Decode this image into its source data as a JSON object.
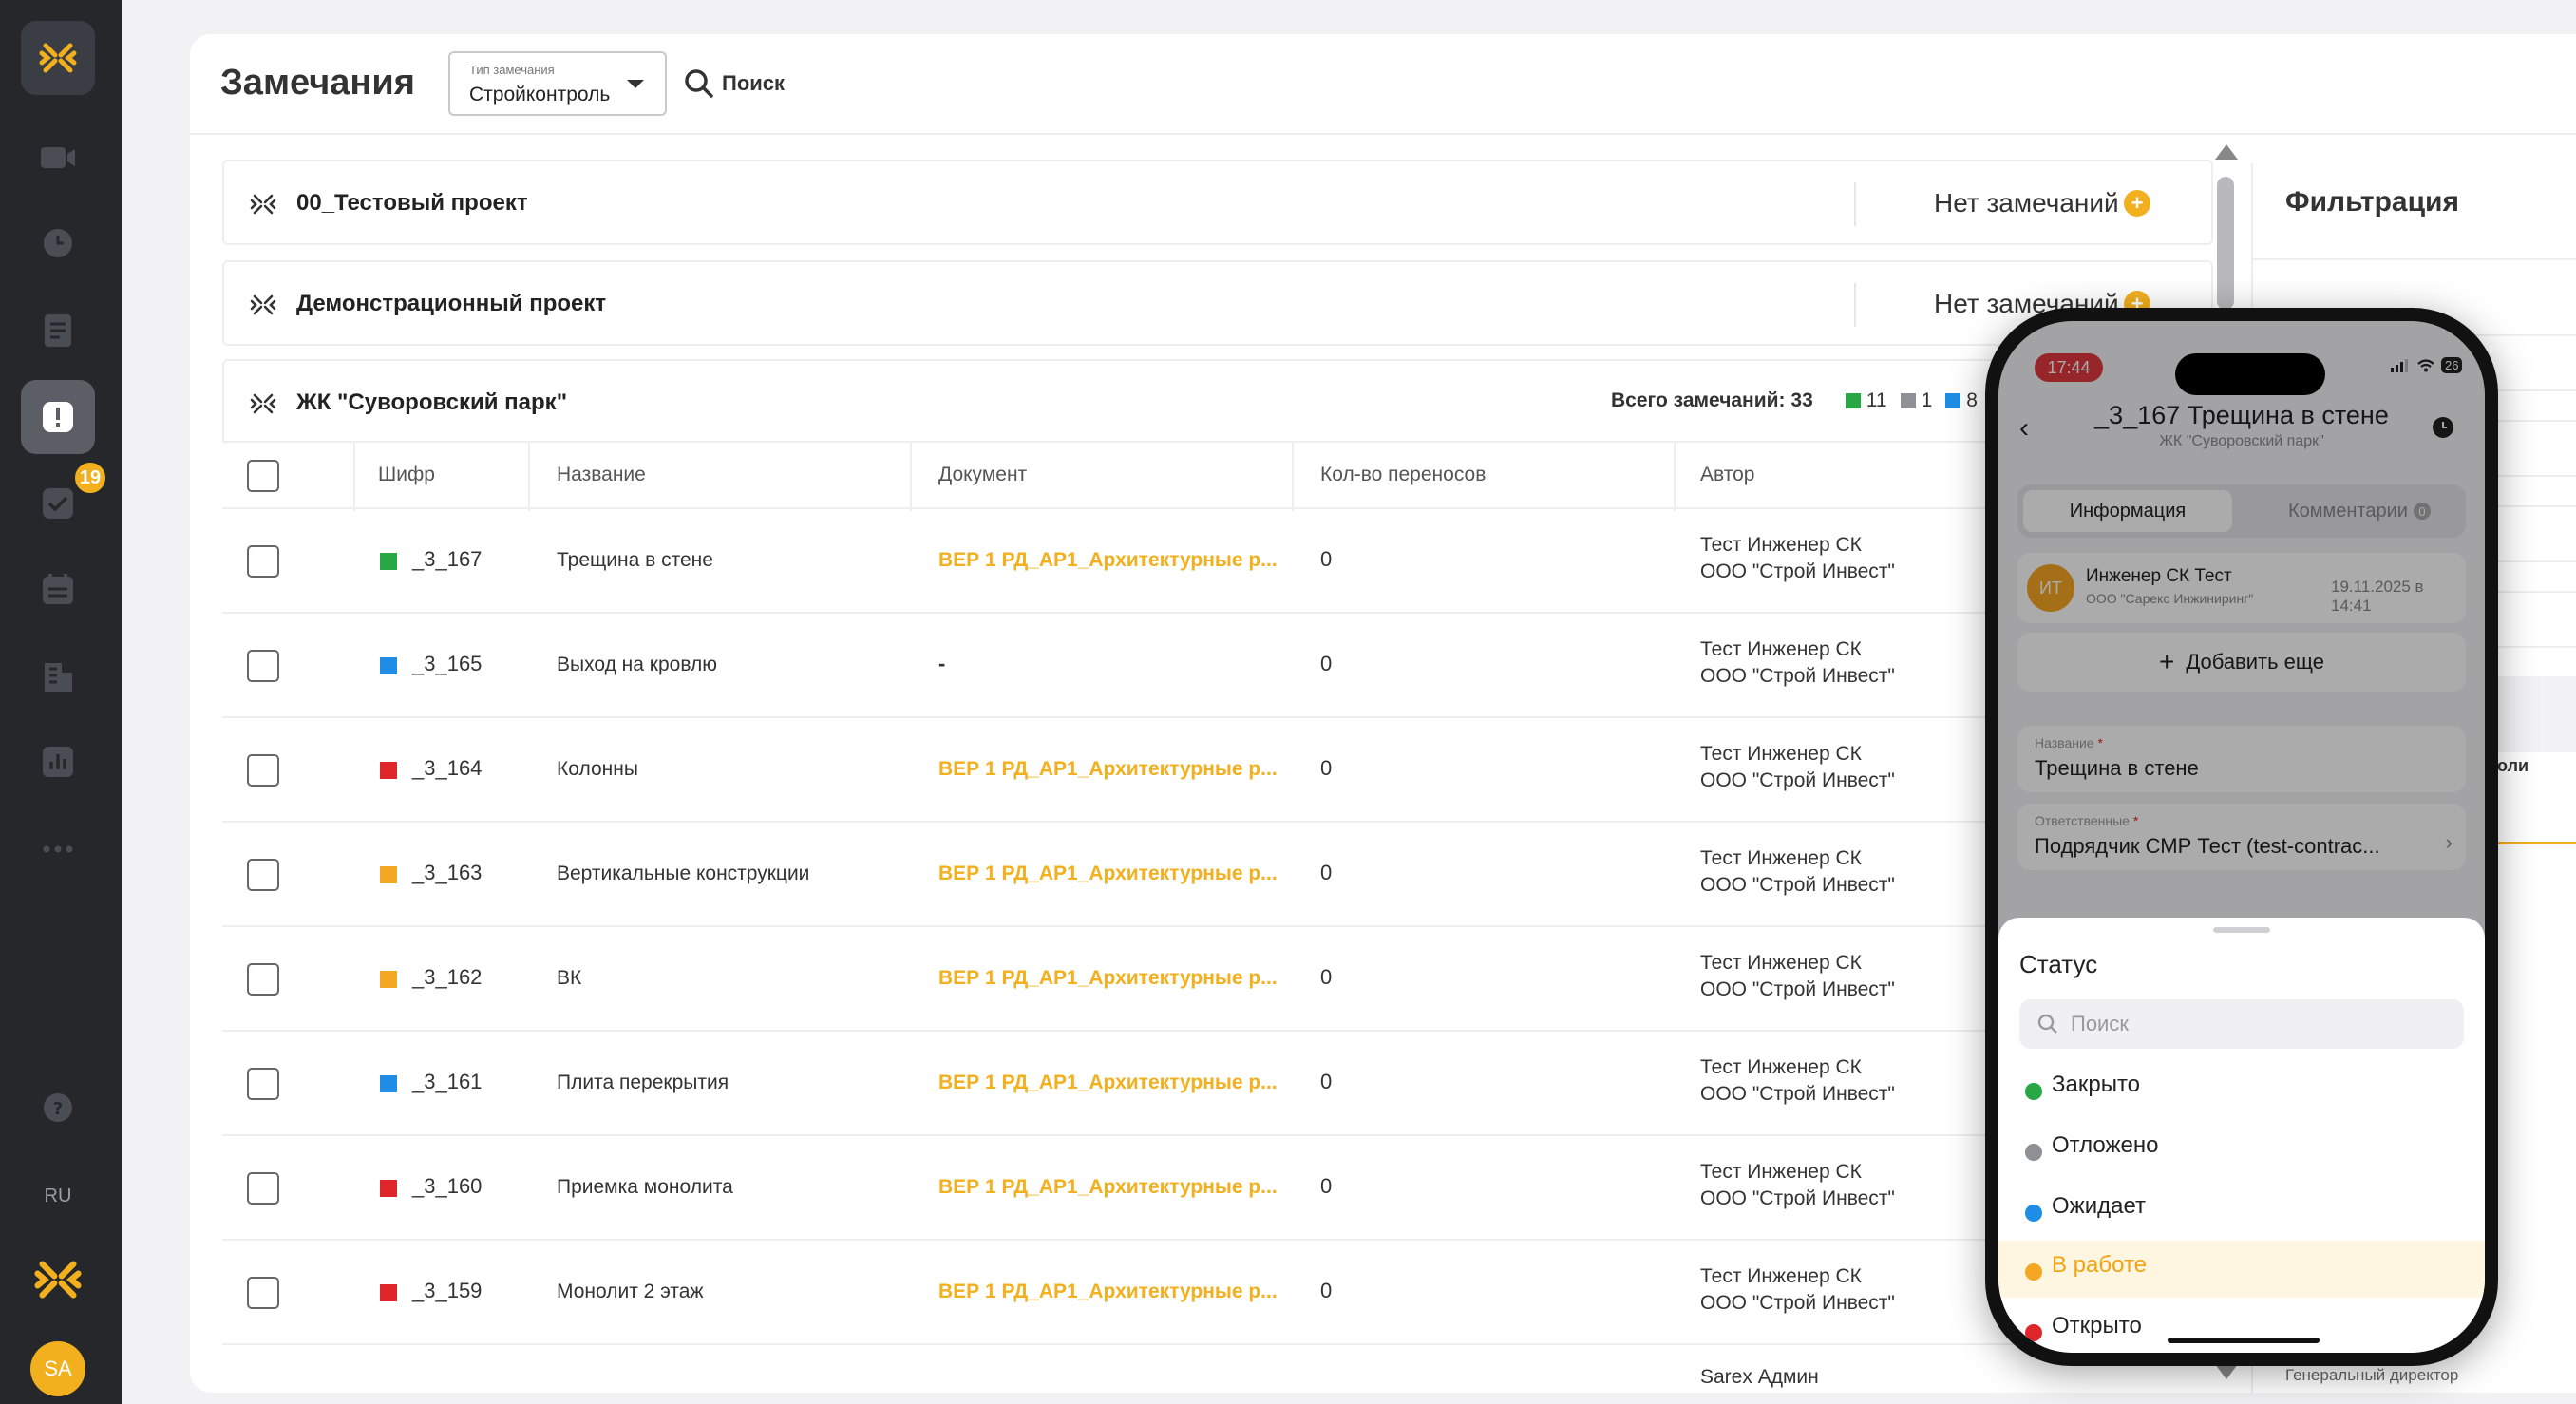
{
  "sidebar": {
    "badge": "19",
    "lang": "RU",
    "avatar": "SA",
    "items": [
      "logo-icon",
      "video-icon",
      "clock-icon",
      "documents-icon",
      "remarks-icon",
      "tasks-icon",
      "calendar-icon",
      "buildings-icon",
      "analytics-icon",
      "more-icon",
      "help-icon"
    ]
  },
  "header": {
    "title": "Замечания",
    "type_label": "Тип замечания",
    "type_value": "Стройконтроль",
    "search": "Поиск"
  },
  "projects": [
    {
      "name": "00_Тестовый проект",
      "status": "Нет замечаний"
    },
    {
      "name": "Демонстрационный проект",
      "status": "Нет замечаний"
    },
    {
      "name": "ЖК \"Суворовский парк\""
    }
  ],
  "stats": {
    "total": "Всего замечаний: 33",
    "green": "11",
    "grey": "1",
    "blue": "8"
  },
  "colors": {
    "accent": "#f2b01e",
    "green": "#27a844",
    "grey": "#8e9096",
    "blue": "#1f8de6",
    "red": "#e0262b",
    "orange": "#f5a623"
  },
  "table": {
    "headers": [
      "Шифр",
      "Название",
      "Документ",
      "Кол-во переносов",
      "Автор"
    ],
    "rows": [
      {
        "code": "_3_167",
        "color": "#27a844",
        "name": "Трещина в стене",
        "doc": "ВЕР 1 РД_АР1_Архитектурные р...",
        "moves": "0",
        "author": "Тест Инженер СК",
        "company": "ООО \"Строй Инвест\""
      },
      {
        "code": "_3_165",
        "color": "#1f8de6",
        "name": "Выход на кровлю",
        "doc": "-",
        "moves": "0",
        "author": "Тест Инженер СК",
        "company": "ООО \"Строй Инвест\""
      },
      {
        "code": "_3_164",
        "color": "#e0262b",
        "name": "Колонны",
        "doc": "ВЕР 1 РД_АР1_Архитектурные р...",
        "moves": "0",
        "author": "Тест Инженер СК",
        "company": "ООО \"Строй Инвест\""
      },
      {
        "code": "_3_163",
        "color": "#f5a623",
        "name": "Вертикальные конструкции",
        "doc": "ВЕР 1 РД_АР1_Архитектурные р...",
        "moves": "0",
        "author": "Тест Инженер СК",
        "company": "ООО \"Строй Инвест\""
      },
      {
        "code": "_3_162",
        "color": "#f5a623",
        "name": "ВК",
        "doc": "ВЕР 1 РД_АР1_Архитектурные р...",
        "moves": "0",
        "author": "Тест Инженер СК",
        "company": "ООО \"Строй Инвест\""
      },
      {
        "code": "_3_161",
        "color": "#1f8de6",
        "name": "Плита перекрытия",
        "doc": "ВЕР 1 РД_АР1_Архитектурные р...",
        "moves": "0",
        "author": "Тест Инженер СК",
        "company": "ООО \"Строй Инвест\""
      },
      {
        "code": "_3_160",
        "color": "#e0262b",
        "name": "Приемка монолита",
        "doc": "ВЕР 1 РД_АР1_Архитектурные р...",
        "moves": "0",
        "author": "Тест Инженер СК",
        "company": "ООО \"Строй Инвест\""
      },
      {
        "code": "_3_159",
        "color": "#e0262b",
        "name": "Монолит 2 этаж",
        "doc": "ВЕР 1 РД_АР1_Архитектурные р...",
        "moves": "0",
        "author": "Тест Инженер СК",
        "company": "ООО \"Строй Инвест\""
      }
    ],
    "partial_author": "Sarex Админ"
  },
  "filter": {
    "title": "Фильтрация",
    "roles_fragment": "и роли",
    "director_fragment": "Генеральный директор"
  },
  "phone": {
    "time": "17:44",
    "battery": "26",
    "title": "_3_167 Трещина в стене",
    "subtitle": "ЖК \"Суворовский парк\"",
    "tab_info": "Информация",
    "tab_comments": "Комментарии",
    "comments_count": "0",
    "avatar": "ИТ",
    "person_name": "Инженер СК Тест",
    "person_company": "ООО \"Сарекс Инжиниринг\"",
    "person_date": "19.11.2025 в 14:41",
    "add_more": "Добавить еще",
    "field_name_label": "Название",
    "field_name_value": "Трещина в стене",
    "field_resp_label": "Ответственные",
    "field_resp_value": "Подрядчик СМР Тест (test-contrac...",
    "sheet_title": "Статус",
    "sheet_search": "Поиск",
    "statuses": [
      {
        "label": "Закрыто",
        "color": "#27a844"
      },
      {
        "label": "Отложено",
        "color": "#8e9096"
      },
      {
        "label": "Ожидает",
        "color": "#1f8de6"
      },
      {
        "label": "В работе",
        "color": "#f5a623"
      },
      {
        "label": "Открыто",
        "color": "#e0262b"
      }
    ]
  }
}
